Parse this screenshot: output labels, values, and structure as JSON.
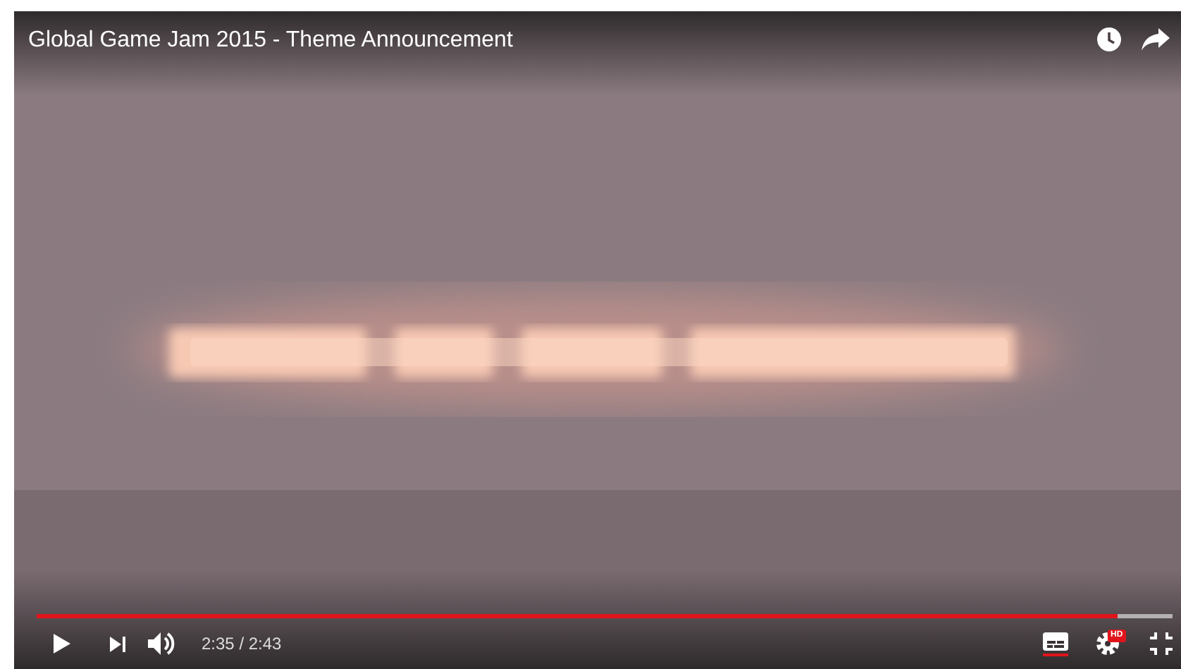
{
  "title": "Global Game Jam 2015 - Theme Announcement",
  "progress": {
    "level": 0.952
  },
  "controls": {
    "time": "2:35 / 2:43",
    "captions": {
      "on": true
    },
    "quality_badge": "HD"
  }
}
